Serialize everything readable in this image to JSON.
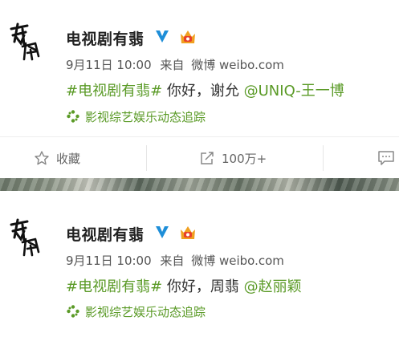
{
  "posts": [
    {
      "account_name": "电视剧有翡",
      "date": "9月11日 10:00",
      "source_prefix": "来自",
      "source": "微博 weibo.com",
      "hashtag": "#电视剧有翡#",
      "text": " 你好，谢允 ",
      "mention": "@UNIQ-王一博",
      "topic": "影视综艺娱乐动态追踪"
    },
    {
      "account_name": "电视剧有翡",
      "date": "9月11日 10:00",
      "source_prefix": "来自",
      "source": "微博 weibo.com",
      "hashtag": "#电视剧有翡#",
      "text": " 你好，周翡 ",
      "mention": "@赵丽颖",
      "topic": "影视综艺娱乐动态追踪"
    }
  ],
  "actions": {
    "favorite_label": "收藏",
    "repost_count": "100万+"
  },
  "colors": {
    "link_green": "#5a9a26",
    "verified_blue": "#1e8ed8",
    "crown_orange": "#f0a020"
  },
  "icons": [
    "logo-calligraphy-icon",
    "verified-v-icon",
    "crown-badge-icon",
    "topic-icon",
    "star-icon",
    "share-icon",
    "comment-icon"
  ]
}
